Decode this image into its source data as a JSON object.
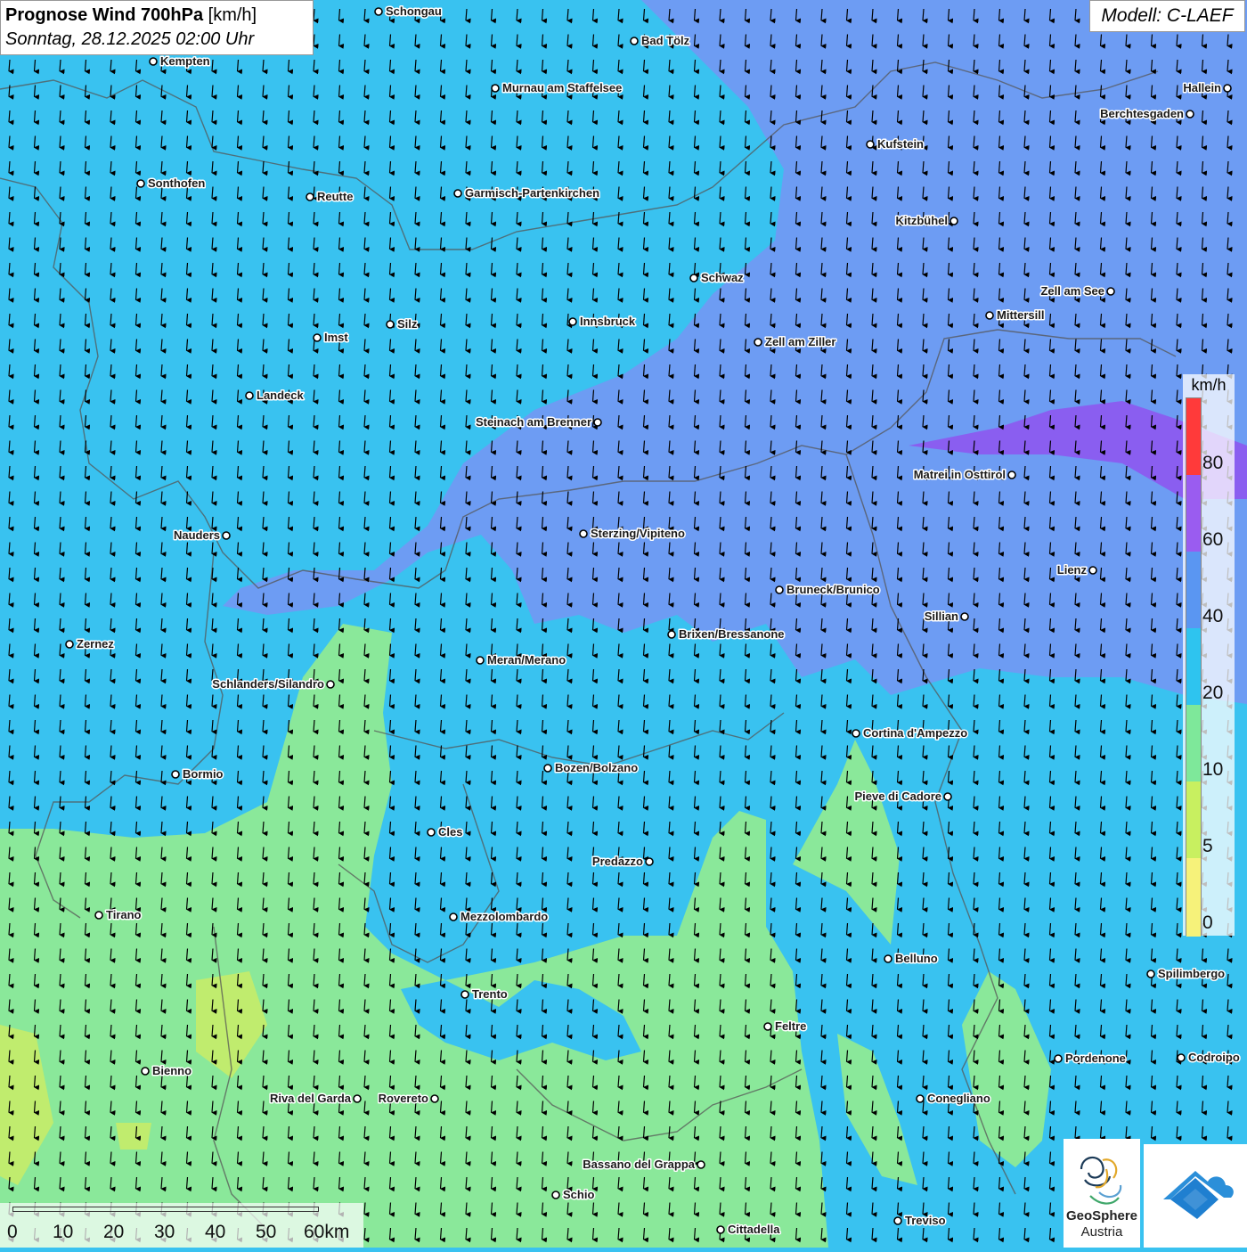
{
  "title": {
    "main": "Prognose Wind 700hPa",
    "unit": "[km/h]",
    "datetime": "Sonntag, 28.12.2025 02:00 Uhr"
  },
  "model": "Modell: C-LAEF",
  "legend": {
    "unit": "km/h",
    "ticks": [
      "80",
      "60",
      "40",
      "20",
      "10",
      "5",
      "0"
    ],
    "colors": [
      "#ff3a3a",
      "#9a5cf0",
      "#5a96f2",
      "#2ec4ef",
      "#7ee89a",
      "#c8f060",
      "#f6f27a"
    ]
  },
  "scale_bar": {
    "labels": [
      "0",
      "10",
      "20",
      "30",
      "40",
      "50",
      "60km"
    ]
  },
  "logos": {
    "geosphere_line1": "GeoSphere",
    "geosphere_line2": "Austria"
  },
  "wind": {
    "direction": "north-to-south",
    "field_colors": {
      "light_blue": "#39c2f0",
      "blue": "#6d9cf3",
      "violet": "#7e72ee",
      "green": "#8ae89a",
      "yellow_green": "#c0ec6e"
    }
  },
  "cities": [
    {
      "name": "Schongau",
      "side": "right"
    },
    {
      "name": "Bad Tölz",
      "side": "right"
    },
    {
      "name": "Kempten",
      "side": "right"
    },
    {
      "name": "Murnau am Staffelsee",
      "side": "right"
    },
    {
      "name": "Hallein",
      "side": "left"
    },
    {
      "name": "Berchtesgaden",
      "side": "left"
    },
    {
      "name": "Kufstein",
      "side": "right"
    },
    {
      "name": "Sonthofen",
      "side": "right"
    },
    {
      "name": "Reutte",
      "side": "right"
    },
    {
      "name": "Garmisch-Partenkirchen",
      "side": "right"
    },
    {
      "name": "Kitzbühel",
      "side": "left"
    },
    {
      "name": "Schwaz",
      "side": "right"
    },
    {
      "name": "Zell am See",
      "side": "left"
    },
    {
      "name": "Innsbruck",
      "side": "right"
    },
    {
      "name": "Mittersill",
      "side": "right"
    },
    {
      "name": "Silz",
      "side": "right"
    },
    {
      "name": "Imst",
      "side": "right"
    },
    {
      "name": "Zell am Ziller",
      "side": "right"
    },
    {
      "name": "Landeck",
      "side": "right"
    },
    {
      "name": "Steinach am Brenner",
      "side": "left"
    },
    {
      "name": "Matrei in Osttirol",
      "side": "left"
    },
    {
      "name": "Nauders",
      "side": "left"
    },
    {
      "name": "Sterzing/Vipiteno",
      "side": "right"
    },
    {
      "name": "Lienz",
      "side": "left"
    },
    {
      "name": "Bruneck/Brunico",
      "side": "right"
    },
    {
      "name": "Sillian",
      "side": "left"
    },
    {
      "name": "Brixen/Bressanone",
      "side": "right"
    },
    {
      "name": "Zernez",
      "side": "right"
    },
    {
      "name": "Meran/Merano",
      "side": "right"
    },
    {
      "name": "Schlanders/Silandro",
      "side": "left"
    },
    {
      "name": "Cortina d'Ampezzo",
      "side": "right"
    },
    {
      "name": "Bozen/Bolzano",
      "side": "right"
    },
    {
      "name": "Bormio",
      "side": "right"
    },
    {
      "name": "Pieve di Cadore",
      "side": "left"
    },
    {
      "name": "Cles",
      "side": "right"
    },
    {
      "name": "Predazzo",
      "side": "left"
    },
    {
      "name": "Tirano",
      "side": "right"
    },
    {
      "name": "Mezzolombardo",
      "side": "right"
    },
    {
      "name": "Belluno",
      "side": "right"
    },
    {
      "name": "Spilimbergo",
      "side": "right"
    },
    {
      "name": "Trento",
      "side": "right"
    },
    {
      "name": "Feltre",
      "side": "right"
    },
    {
      "name": "Pordenone",
      "side": "right"
    },
    {
      "name": "Codroipo",
      "side": "right"
    },
    {
      "name": "Bienno",
      "side": "right"
    },
    {
      "name": "Riva del Garda",
      "side": "left"
    },
    {
      "name": "Rovereto",
      "side": "left"
    },
    {
      "name": "Conegliano",
      "side": "right"
    },
    {
      "name": "Bassano del Grappa",
      "side": "left"
    },
    {
      "name": "Schio",
      "side": "right"
    },
    {
      "name": "Treviso",
      "side": "right"
    },
    {
      "name": "Cittadella",
      "side": "right"
    }
  ]
}
